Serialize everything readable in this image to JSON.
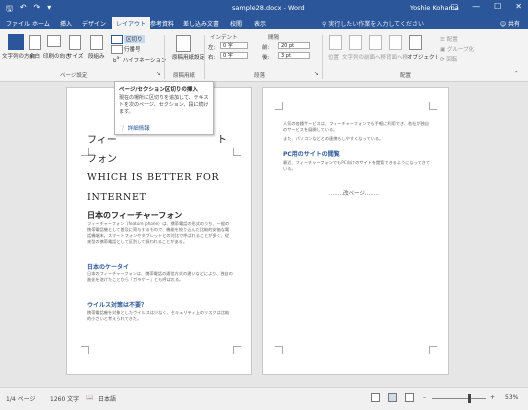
{
  "titlebar": {
    "document_title": "sample28.docx - Word",
    "user": "Yoshie Kohama",
    "save_icon": "save-icon",
    "undo_icon": "undo-icon",
    "redo_icon": "redo-icon"
  },
  "tabs": [
    "ファイル",
    "ホーム",
    "挿入",
    "デザイン",
    "レイアウト",
    "参考資料",
    "差し込み文書",
    "校閲",
    "表示"
  ],
  "active_tab": "レイアウト",
  "tell_me": "実行したい作業を入力してください",
  "share": "共有",
  "ribbon": {
    "page_setup": {
      "label": "ページ設定",
      "text_direction": "文字列の方向",
      "margins": "余白",
      "orientation": "印刷の向き",
      "size": "サイズ",
      "columns": "段組み",
      "breaks": "区切り",
      "line_numbers": "行番号",
      "hyphenation": "ハイフネーション"
    },
    "manuscript": {
      "label": "原稿用紙",
      "button": "原稿用紙設定"
    },
    "paragraph": {
      "label": "段落",
      "indent": "インデント",
      "spacing": "間隔",
      "left_label": "左:",
      "left_value": "0 字",
      "right_label": "右:",
      "right_value": "0 字",
      "before_label": "前:",
      "before_value": "20 pt",
      "after_label": "後:",
      "after_value": "3 pt"
    },
    "arrange": {
      "label": "配置",
      "position": "位置",
      "wrap": "文字列の折り返し",
      "forward": "前面へ移動",
      "backward": "背面へ移動",
      "selection_pane": "オブジェクトの選択と表示",
      "align": "配置",
      "group": "グループ化",
      "rotate": "回転"
    }
  },
  "tooltip": {
    "title": "ページ/セクション区切りの挿入",
    "description": "現在の場所に区切りを追加して、テキストを次のページ、セクション、段に続けます。",
    "more_info": "詳細情報"
  },
  "page1": {
    "heading_jp_1": "フィー",
    "heading_jp_1b": "ト",
    "heading_jp_2": "フォン",
    "heading_en_1": "WHICH IS BETTER FOR",
    "heading_en_2": "INTERNET",
    "section1": "日本のフィーチャーフォン",
    "para1": "フィーチャーフォン（feature phone）は、携帯電話の形式のうち、一般の携帯電話機として普及に寄与するもので、機能を絞り込んだ比較的安価な電話機端末。スマートフォンやタブレットとの対比で呼ばれることが多く、従来型の携帯電話として区別して扱われることがある。",
    "section2": "日本のケータイ",
    "para2": "日本のフィーチャーフォンは、携帯電話の通信方式の違いなどにより、独自の進化を遂げたことから「ガラケー」とも呼ばれる。",
    "section3": "ウイルス対策は不要？",
    "para3": "携帯電話機を対象としたウイルスは少なく、セキュリティ上のリスクは比較的小さいと考えられてきた。"
  },
  "page2": {
    "para1": "人気の各種サービスは、フィーチャーフォンでも手軽に利用でき、各社が独自のサービスを展開している。",
    "para2": "また、パソコンなどとの連携もしやすくなっている。",
    "section1": "PC用のサイトの閲覧",
    "para3": "最近、フィーチャーフォンでもPC向けのサイトを閲覧できるようになってきている。",
    "footer": "改ページ"
  },
  "statusbar": {
    "page": "1/4 ページ",
    "words": "1260 文字",
    "language": "日本語",
    "zoom": "53%"
  }
}
